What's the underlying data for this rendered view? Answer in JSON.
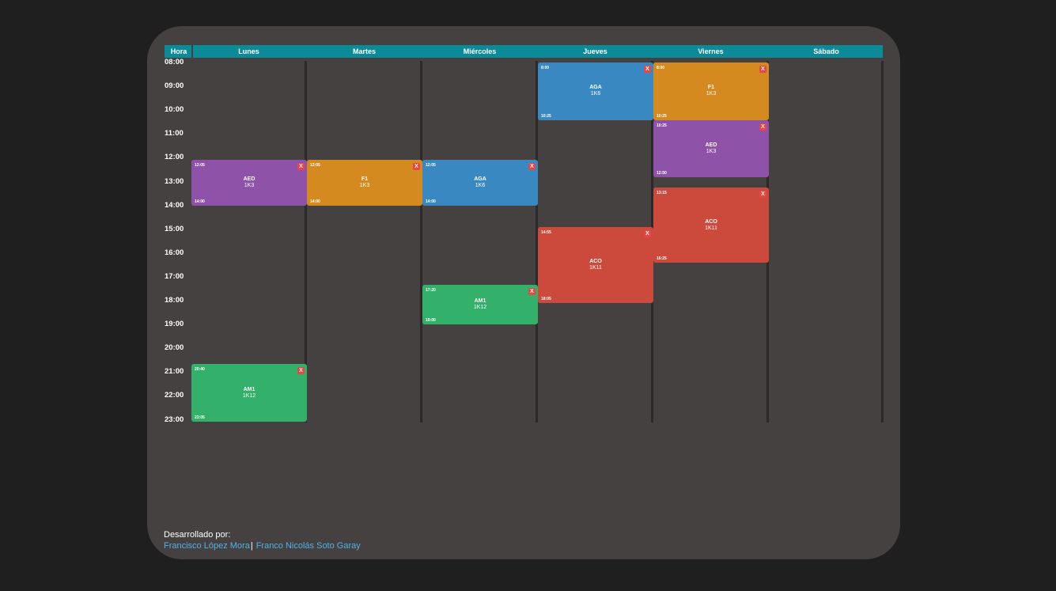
{
  "header": {
    "hour_label": "Hora",
    "days": [
      "Lunes",
      "Martes",
      "Miércoles",
      "Jueves",
      "Viernes",
      "Sábado"
    ]
  },
  "hours": [
    "08:00",
    "09:00",
    "10:00",
    "11:00",
    "12:00",
    "13:00",
    "14:00",
    "15:00",
    "16:00",
    "17:00",
    "18:00",
    "19:00",
    "20:00",
    "21:00",
    "22:00",
    "23:00"
  ],
  "colors": {
    "purple": "#8e53a8",
    "orange": "#d48a1e",
    "blue": "#3a88c2",
    "red": "#cc4a3c",
    "green": "#33b06a",
    "close_button": "#e84545",
    "header": "#0b8a98",
    "link": "#4fb3e8"
  },
  "close_label": "X",
  "events": [
    {
      "day": 0,
      "start": "12:05",
      "end": "14:00",
      "subject": "AED",
      "course": "1K3",
      "color": "purple"
    },
    {
      "day": 0,
      "start": "20:40",
      "end": "23:05",
      "subject": "AM1",
      "course": "1K12",
      "color": "green"
    },
    {
      "day": 1,
      "start": "12:05",
      "end": "14:00",
      "subject": "F1",
      "course": "1K3",
      "color": "orange"
    },
    {
      "day": 2,
      "start": "12:05",
      "end": "14:00",
      "subject": "AGA",
      "course": "1K6",
      "color": "blue"
    },
    {
      "day": 2,
      "start": "17:20",
      "end": "19:00",
      "subject": "AM1",
      "course": "1K12",
      "color": "green"
    },
    {
      "day": 3,
      "start": "8:00",
      "end": "10:25",
      "subject": "AGA",
      "course": "1K6",
      "color": "blue"
    },
    {
      "day": 3,
      "start": "14:55",
      "end": "18:05",
      "subject": "ACO",
      "course": "1K11",
      "color": "red"
    },
    {
      "day": 4,
      "start": "8:00",
      "end": "10:25",
      "subject": "F1",
      "course": "1K3",
      "color": "orange"
    },
    {
      "day": 4,
      "start": "10:25",
      "end": "12:50",
      "subject": "AED",
      "course": "1K3",
      "color": "purple"
    },
    {
      "day": 4,
      "start": "13:15",
      "end": "16:25",
      "subject": "ACO",
      "course": "1K11",
      "color": "red"
    }
  ],
  "credits": {
    "label": "Desarrollado por:",
    "authors": [
      "Francisco López Mora",
      "Franco Nicolás Soto Garay"
    ]
  }
}
